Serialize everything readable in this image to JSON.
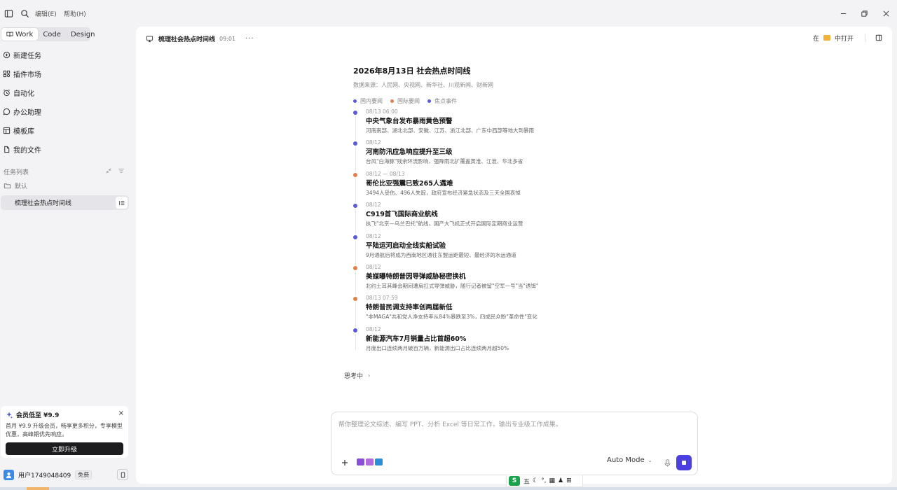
{
  "topbar": {
    "menus": [
      "编辑(E)",
      "帮助(H)"
    ]
  },
  "sidebar": {
    "mode_tabs": [
      {
        "label": "Work",
        "active": true
      },
      {
        "label": "Code",
        "active": false
      },
      {
        "label": "Design",
        "active": false
      }
    ],
    "nav": [
      {
        "label": "新建任务",
        "icon": "new-task-icon"
      },
      {
        "label": "插件市场",
        "icon": "plugin-grid-icon"
      },
      {
        "label": "自动化",
        "icon": "alarm-clock-icon"
      },
      {
        "label": "办公助理",
        "icon": "chat-bubble-icon"
      },
      {
        "label": "模板库",
        "icon": "template-icon"
      },
      {
        "label": "我的文件",
        "icon": "file-icon"
      }
    ],
    "task_section_label": "任务列表",
    "folder_label": "默认",
    "current_task": "梳理社会热点时间线",
    "promo": {
      "title": "会员低至 ¥9.9",
      "desc": "首月 ¥9.9 升级会员，畅享更多积分，专享模型优惠，高峰期优先响应。",
      "button": "立即升级",
      "close": "×"
    },
    "user": {
      "name": "用户1749048409",
      "badge": "免费"
    }
  },
  "chat": {
    "title": "梳理社会热点时间线",
    "time": "09:01",
    "more": "···",
    "open_in_prefix": "在",
    "open_in_suffix": "中打开"
  },
  "doc": {
    "title": "2026年8月13日 社会热点时间线",
    "source": "数据来源：人民网、央视网、新华社、川观新闻、财新网",
    "legend": [
      {
        "label": "国内要闻",
        "color": "#5b5bd6"
      },
      {
        "label": "国际要闻",
        "color": "#e0804a"
      },
      {
        "label": "焦点事件",
        "color": "#5b5bd6"
      }
    ],
    "events": [
      {
        "date": "08/13 06:00",
        "title": "中央气象台发布暴雨黄色预警",
        "desc": "河南南部、湖北北部、安徽、江苏、浙江北部、广东中西部等地大到暴雨",
        "color": "#5b5bd6"
      },
      {
        "date": "08/12",
        "title": "河南防汛应急响应提升至三级",
        "desc": "台风\"白海豚\"残余环流影响，强降雨北扩覆盖黄淮、江淮、华北多省",
        "color": "#5b5bd6"
      },
      {
        "date": "08/12 — 08/13",
        "title": "哥伦比亚强震已致265人遇难",
        "desc": "3494人受伤、496人失踪，政府宣布经济紧急状态及三天全国哀悼",
        "color": "#e0804a"
      },
      {
        "date": "08/12",
        "title": "C919首飞国际商业航线",
        "desc": "执飞\"北京—乌兰巴托\"航线，国产大飞机正式开启国际定期商业运营",
        "color": "#5b5bd6"
      },
      {
        "date": "08/12",
        "title": "平陆运河启动全线实船试验",
        "desc": "9月通航后将成为西南地区通往东盟运距最短、最经济的水运通道",
        "color": "#5b5bd6"
      },
      {
        "date": "08/12",
        "title": "美媒曝特朗普因导弹威胁秘密换机",
        "desc": "北约土耳其峰会期间遭肩扛式导弹威胁，随行记者被留\"空军一号\"当\"诱饵\"",
        "color": "#e0804a"
      },
      {
        "date": "08/13 07:59",
        "title": "特朗普民调支持率创两届新低",
        "desc": "\"非MAGA\"共和党人净支持率从84%暴跌至3%，四成民众盼\"革命性\"变化",
        "color": "#e0804a"
      },
      {
        "date": "08/12",
        "title": "新能源汽车7月销量占比首超60%",
        "desc": "月度出口连续两月破百万辆，新能源出口占比连续两月超50%",
        "color": "#5b5bd6"
      }
    ],
    "thinking": "思考中",
    "thinking_chevron": "›"
  },
  "composer": {
    "placeholder": "帮你整理论文综述、编写 PPT、分析 Excel 等日常工作，输出专业级工作成果。",
    "mode": "Auto Mode",
    "mode_chevron": "⌄"
  },
  "ime": {
    "logo": "S",
    "items": [
      "五",
      "☾",
      "°,",
      "▦",
      "♟",
      "⊞"
    ]
  }
}
